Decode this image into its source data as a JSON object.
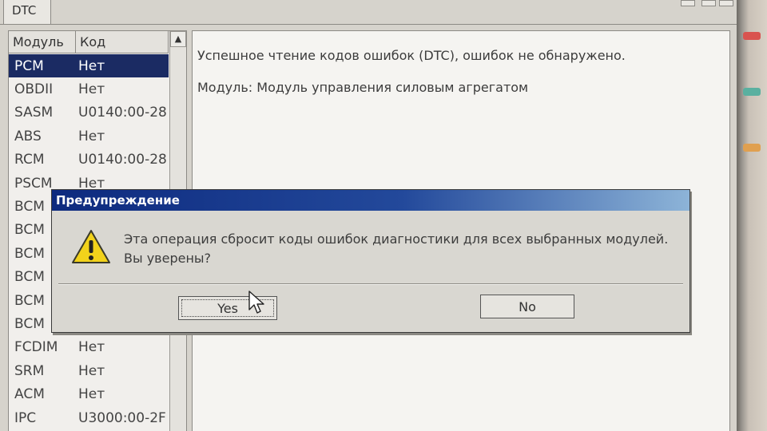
{
  "tab": {
    "label": "DTC"
  },
  "module_list": {
    "columns": [
      "Модуль",
      "Код"
    ],
    "rows": [
      {
        "module": "PCM",
        "code": "Нет",
        "selected": true
      },
      {
        "module": "OBDII",
        "code": "Нет"
      },
      {
        "module": "SASM",
        "code": "U0140:00-28"
      },
      {
        "module": "ABS",
        "code": "Нет"
      },
      {
        "module": "RCM",
        "code": "U0140:00-28"
      },
      {
        "module": "PSCM",
        "code": "Нет"
      },
      {
        "module": "BCM",
        "code": ""
      },
      {
        "module": "BCM",
        "code": ""
      },
      {
        "module": "BCM",
        "code": ""
      },
      {
        "module": "BCM",
        "code": ""
      },
      {
        "module": "BCM",
        "code": ""
      },
      {
        "module": "BCM",
        "code": ""
      },
      {
        "module": "FCDIM",
        "code": "Нет"
      },
      {
        "module": "SRM",
        "code": "Нет"
      },
      {
        "module": "ACM",
        "code": "Нет"
      },
      {
        "module": "IPC",
        "code": "U3000:00-2F"
      }
    ]
  },
  "info_panel": {
    "line1": "Успешное чтение кодов ошибок (DTC), ошибок не обнаружено.",
    "line2": "Модуль: Модуль управления силовым агрегатом"
  },
  "dialog": {
    "title": "Предупреждение",
    "icon": "warning-icon",
    "message_line1": "Эта операция сбросит коды ошибок диагностики для всех выбранных модулей.",
    "message_line2": "Вы уверены?",
    "yes_label": "Yes",
    "no_label": "No"
  },
  "colors": {
    "selection": "#1b2b63",
    "title_bar_start": "#0d2a7e",
    "title_bar_end": "#8db4d8",
    "warning_yellow": "#f2d21b"
  }
}
